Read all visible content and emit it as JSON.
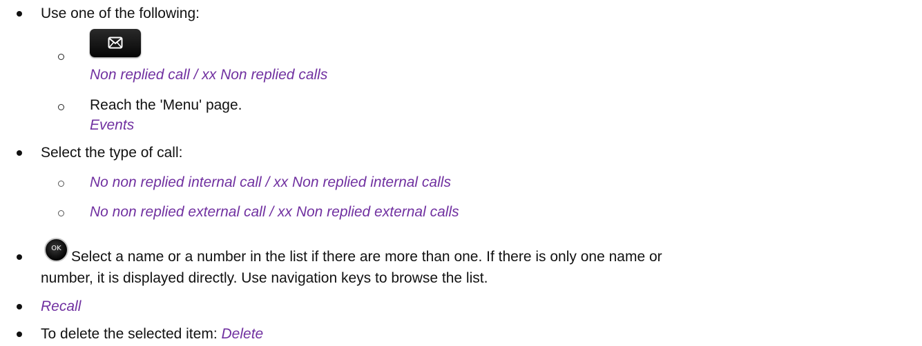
{
  "steps": {
    "use_one": "Use one of the following:",
    "option_message_key_result": "Non replied call / xx Non replied calls",
    "option_menu_label": "Reach the 'Menu' page.",
    "option_menu_result": "Events",
    "select_type": "Select the type of call:",
    "type_internal": "No non replied internal call / xx Non replied internal calls",
    "type_external": "No non replied external call / xx Non replied external calls",
    "ok_key_label": "OK",
    "select_name_line1": "Select a name or a number in the list if there are more than one. If there is only one name or",
    "select_name_line2": "number, it is displayed directly. Use navigation keys to browse the list.",
    "recall": "Recall",
    "delete_prefix": "To delete the selected item: ",
    "delete_label": "Delete"
  },
  "icons": {
    "message_key": "envelope-icon",
    "ok_key": "ok-key-icon"
  },
  "colors": {
    "text": "#111111",
    "highlight": "#7030a0"
  }
}
